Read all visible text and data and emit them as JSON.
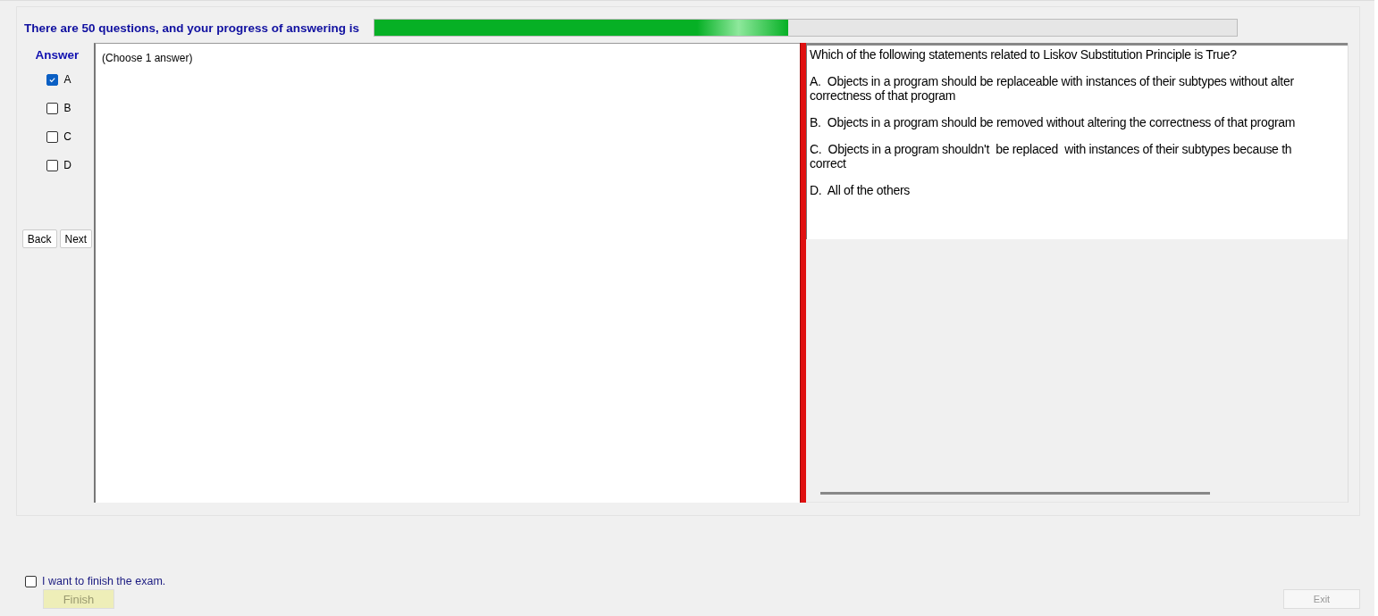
{
  "header": {
    "text": "There are 50 questions, and your progress of answering is",
    "progress": {
      "level": 0.48
    }
  },
  "answer": {
    "title": "Answer",
    "options": [
      {
        "label": "A",
        "checked": true
      },
      {
        "label": "B",
        "checked": false
      },
      {
        "label": "C",
        "checked": false
      },
      {
        "label": "D",
        "checked": false
      }
    ],
    "buttons": [
      {
        "label": "Back"
      },
      {
        "label": "Next"
      }
    ]
  },
  "answer_area": {
    "hint": "(Choose 1 answer)"
  },
  "question": {
    "text": "Which of the following statements related to Liskov Substitution Principle is True?",
    "options": [
      {
        "lines": [
          "A.  Objects in a program should be replaceable with instances of their subtypes without alter",
          "correctness of that program"
        ]
      },
      {
        "lines": [
          "B.  Objects in a program should be removed without altering the correctness of that program"
        ]
      },
      {
        "lines": [
          "C.  Objects in a program shouldn't  be replaced  with instances of their subtypes because th",
          "correct"
        ]
      },
      {
        "lines": [
          "D.  All of the others"
        ]
      }
    ]
  },
  "finish": {
    "label": "I want to finish the exam.",
    "checked": false,
    "button": {
      "label": "Finish",
      "disabled": true
    }
  },
  "exit_button": {
    "label": "Exit",
    "disabled": true
  }
}
